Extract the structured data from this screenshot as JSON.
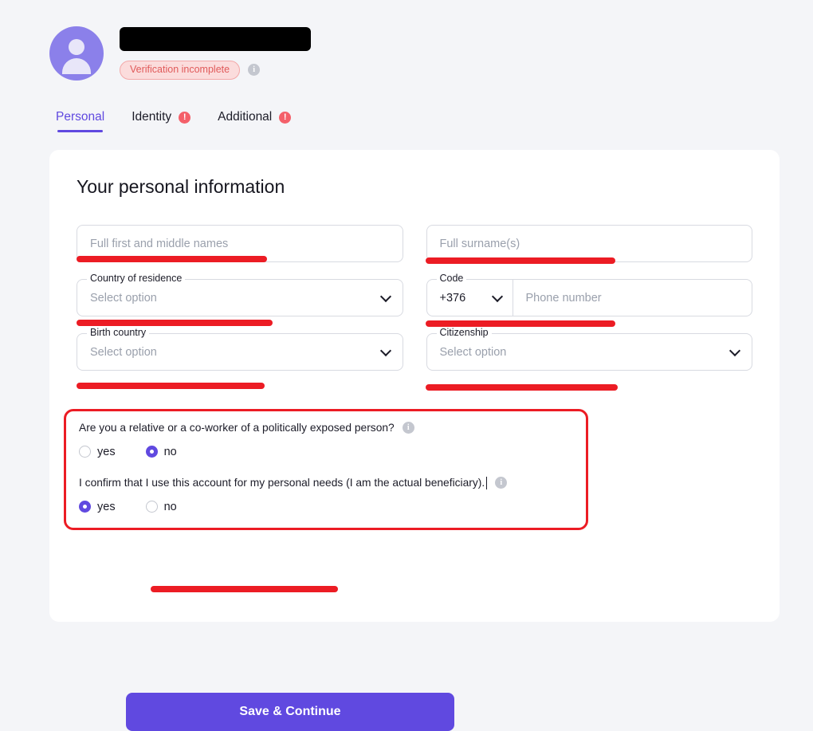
{
  "profile": {
    "name_redacted": "",
    "status_badge": "Verification incomplete",
    "info_glyph": "i"
  },
  "tabs": [
    {
      "label": "Personal",
      "active": true,
      "warning": false
    },
    {
      "label": "Identity",
      "active": false,
      "warning": true
    },
    {
      "label": "Additional",
      "active": false,
      "warning": true
    }
  ],
  "warning_glyph": "!",
  "card": {
    "title": "Your personal information",
    "fields": {
      "first_names_placeholder": "Full first and middle names",
      "surnames_placeholder": "Full surname(s)",
      "country_residence_label": "Country of residence",
      "country_residence_value": "Select option",
      "code_label": "Code",
      "code_value": "+376",
      "phone_placeholder": "Phone number",
      "birth_country_label": "Birth country",
      "birth_country_value": "Select option",
      "citizenship_label": "Citizenship",
      "citizenship_value": "Select option"
    },
    "questions": [
      {
        "text": "Are you a relative or a co-worker of a politically exposed person?",
        "yes_label": "yes",
        "no_label": "no",
        "selected": "no"
      },
      {
        "text": "I confirm that I use this account for my personal needs (I am the actual beneficiary).",
        "yes_label": "yes",
        "no_label": "no",
        "selected": "yes"
      }
    ],
    "save_label": "Save & Continue"
  },
  "colors": {
    "accent": "#6049e0",
    "annotation": "#ec1c24",
    "warning": "#f4606a",
    "badge_bg": "#fbdcdc",
    "badge_text": "#e05a5a",
    "page_bg": "#f4f5f8"
  }
}
